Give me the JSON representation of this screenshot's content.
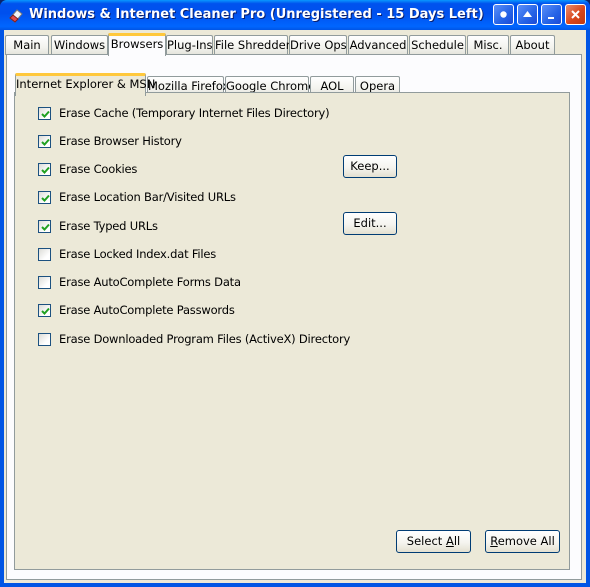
{
  "window": {
    "title": "Windows & Internet Cleaner Pro (Unregistered - 15 Days Left)",
    "app_icon": "eraser-icon",
    "controls": [
      "help-icon",
      "minimize-icon",
      "restore-icon",
      "close-icon"
    ]
  },
  "main_tabs": [
    {
      "label": "Main"
    },
    {
      "label": "Windows"
    },
    {
      "label": "Browsers",
      "active": true
    },
    {
      "label": "Plug-Ins"
    },
    {
      "label": "File Shredder"
    },
    {
      "label": "Drive Ops"
    },
    {
      "label": "Advanced"
    },
    {
      "label": "Schedule"
    },
    {
      "label": "Misc."
    },
    {
      "label": "About"
    }
  ],
  "browser_tabs": [
    {
      "label": "Internet Explorer & MSN",
      "active": true
    },
    {
      "label": "Mozilla Firefox"
    },
    {
      "label": "Google Chrome"
    },
    {
      "label": "AOL"
    },
    {
      "label": "Opera"
    }
  ],
  "options": [
    {
      "label": "Erase Cache (Temporary Internet Files Directory)",
      "checked": true
    },
    {
      "label": "Erase Browser History",
      "checked": true
    },
    {
      "label": "Erase Cookies",
      "checked": true
    },
    {
      "label": "Erase Location Bar/Visited URLs",
      "checked": true
    },
    {
      "label": "Erase Typed URLs",
      "checked": true
    },
    {
      "label": "Erase Locked Index.dat Files",
      "checked": false
    },
    {
      "label": "Erase AutoComplete Forms Data",
      "checked": false
    },
    {
      "label": "Erase AutoComplete Passwords",
      "checked": true
    },
    {
      "label": "Erase Downloaded Program Files (ActiveX) Directory",
      "checked": false
    }
  ],
  "buttons": {
    "keep": "Keep...",
    "edit": "Edit...",
    "select_all_pre": "Select ",
    "select_all_acc": "A",
    "select_all_post": "ll",
    "remove_all_acc": "R",
    "remove_all_post": "emove All"
  },
  "colors": {
    "title_bar": "#0055e5",
    "face": "#ece9d8",
    "active_tab_highlight": "#ffc83c",
    "check": "#21a121"
  }
}
